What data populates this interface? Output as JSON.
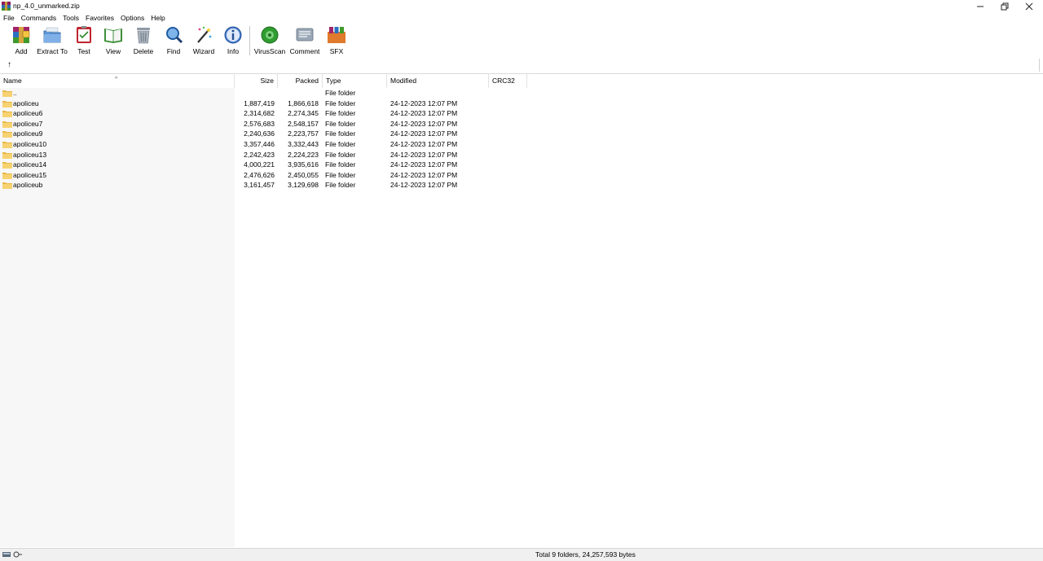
{
  "window": {
    "title": "np_4.0_unmarked.zip",
    "controls": [
      "minimize",
      "restore",
      "close"
    ]
  },
  "menu": [
    "File",
    "Commands",
    "Tools",
    "Favorites",
    "Options",
    "Help"
  ],
  "toolbar": [
    {
      "label": "Add",
      "icon": "archive-add-icon"
    },
    {
      "label": "Extract To",
      "icon": "extract-folder-icon"
    },
    {
      "label": "Test",
      "icon": "test-clipboard-icon"
    },
    {
      "label": "View",
      "icon": "view-book-icon"
    },
    {
      "label": "Delete",
      "icon": "trash-icon"
    },
    {
      "label": "Find",
      "icon": "magnifier-icon"
    },
    {
      "label": "Wizard",
      "icon": "wand-icon"
    },
    {
      "label": "Info",
      "icon": "info-icon"
    },
    {
      "label": "VirusScan",
      "icon": "virus-scan-icon"
    },
    {
      "label": "Comment",
      "icon": "comment-icon"
    },
    {
      "label": "SFX",
      "icon": "sfx-box-icon"
    }
  ],
  "address": {
    "up_icon": "up-arrow-icon"
  },
  "columns": {
    "name": "Name",
    "size": "Size",
    "packed": "Packed",
    "type": "Type",
    "modified": "Modified",
    "crc": "CRC32"
  },
  "files": [
    {
      "name": "..",
      "size": "",
      "packed": "",
      "type": "File folder",
      "modified": ""
    },
    {
      "name": "apoliceu",
      "size": "1,887,419",
      "packed": "1,866,618",
      "type": "File folder",
      "modified": "24-12-2023 12:07 PM"
    },
    {
      "name": "apoliceu6",
      "size": "2,314,682",
      "packed": "2,274,345",
      "type": "File folder",
      "modified": "24-12-2023 12:07 PM"
    },
    {
      "name": "apoliceu7",
      "size": "2,576,683",
      "packed": "2,548,157",
      "type": "File folder",
      "modified": "24-12-2023 12:07 PM"
    },
    {
      "name": "apoliceu9",
      "size": "2,240,636",
      "packed": "2,223,757",
      "type": "File folder",
      "modified": "24-12-2023 12:07 PM"
    },
    {
      "name": "apoliceu10",
      "size": "3,357,446",
      "packed": "3,332,443",
      "type": "File folder",
      "modified": "24-12-2023 12:07 PM"
    },
    {
      "name": "apoliceu13",
      "size": "2,242,423",
      "packed": "2,224,223",
      "type": "File folder",
      "modified": "24-12-2023 12:07 PM"
    },
    {
      "name": "apoliceu14",
      "size": "4,000,221",
      "packed": "3,935,616",
      "type": "File folder",
      "modified": "24-12-2023 12:07 PM"
    },
    {
      "name": "apoliceu15",
      "size": "2,476,626",
      "packed": "2,450,055",
      "type": "File folder",
      "modified": "24-12-2023 12:07 PM"
    },
    {
      "name": "apoliceub",
      "size": "3,161,457",
      "packed": "3,129,698",
      "type": "File folder",
      "modified": "24-12-2023 12:07 PM"
    }
  ],
  "status": {
    "text": "Total 9 folders, 24,257,593 bytes"
  }
}
